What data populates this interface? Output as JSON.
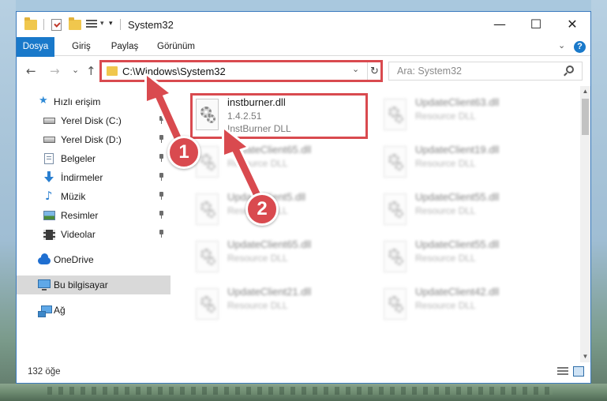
{
  "window": {
    "title": "System32",
    "controls": {
      "minimize": "—",
      "maximize": "☐",
      "close": "✕"
    }
  },
  "quick_access_toolbar": {
    "icons": [
      "folder-icon",
      "properties-icon",
      "new-folder-icon",
      "view-icon",
      "customize-dropdown-icon"
    ]
  },
  "ribbon": {
    "tabs": [
      "Dosya",
      "Giriş",
      "Paylaş",
      "Görünüm"
    ],
    "help_label": "?"
  },
  "navigation": {
    "back": "←",
    "forward": "→",
    "recent": "⌄",
    "up": "↑"
  },
  "address_bar": {
    "path": "C:\\Windows\\System32",
    "refresh": "↻",
    "dropdown": "⌄"
  },
  "search": {
    "placeholder": "Ara: System32"
  },
  "nav_pane": {
    "items": [
      {
        "label": "Hızlı erişim",
        "icon": "star-icon",
        "pinned": false
      },
      {
        "label": "Yerel Disk (C:)",
        "icon": "drive-icon",
        "pinned": true
      },
      {
        "label": "Yerel Disk (D:)",
        "icon": "drive-icon",
        "pinned": true
      },
      {
        "label": "Belgeler",
        "icon": "documents-icon",
        "pinned": true
      },
      {
        "label": "İndirmeler",
        "icon": "download-icon",
        "pinned": true
      },
      {
        "label": "Müzik",
        "icon": "music-icon",
        "pinned": true
      },
      {
        "label": "Resimler",
        "icon": "pictures-icon",
        "pinned": true
      },
      {
        "label": "Videolar",
        "icon": "videos-icon",
        "pinned": true
      },
      {
        "label": "OneDrive",
        "icon": "onedrive-icon",
        "pinned": false
      },
      {
        "label": "Bu bilgisayar",
        "icon": "this-pc-icon",
        "pinned": false,
        "selected": true
      },
      {
        "label": "Ağ",
        "icon": "network-icon",
        "pinned": false
      }
    ]
  },
  "files": [
    {
      "name": "instburner.dll",
      "line2": "1.4.2.51",
      "line3": "InstBurner DLL",
      "highlighted": true
    },
    {
      "name": "UpdateClient63.dll",
      "line2": "Resource DLL",
      "blurred": true
    },
    {
      "name": "UpdateClient65.dll",
      "line2": "Resource DLL",
      "blurred": true
    },
    {
      "name": "UpdateClient19.dll",
      "line2": "Resource DLL",
      "blurred": true
    },
    {
      "name": "UpdateClient5.dll",
      "line2": "Resource DLL",
      "blurred": true
    },
    {
      "name": "UpdateClient55.dll",
      "line2": "Resource DLL",
      "blurred": true
    },
    {
      "name": "UpdateClient65.dll",
      "line2": "Resource DLL",
      "blurred": true
    },
    {
      "name": "UpdateClient55.dll",
      "line2": "Resource DLL",
      "blurred": true
    },
    {
      "name": "UpdateClient21.dll",
      "line2": "Resource DLL",
      "blurred": true
    },
    {
      "name": "UpdateClient42.dll",
      "line2": "Resource DLL",
      "blurred": true
    }
  ],
  "status_bar": {
    "item_count": "132 öğe"
  },
  "annotations": {
    "badge_1": "1",
    "badge_2": "2",
    "color": "#d94a4f"
  },
  "colors": {
    "accent": "#1979ca",
    "annotation_red": "#d94a4f",
    "folder_yellow": "#f0c74d"
  }
}
